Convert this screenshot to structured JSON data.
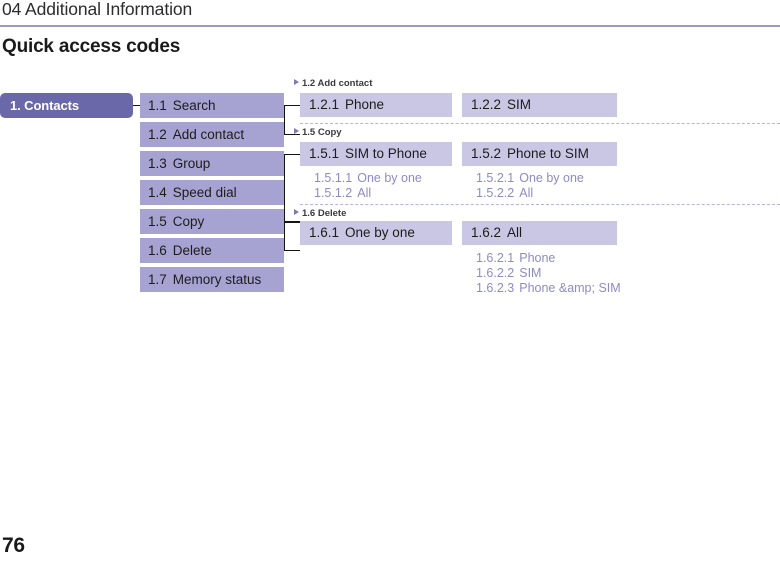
{
  "header": {
    "chapter": "04 Additional Information",
    "title": "Quick access codes",
    "rule_color": "#9c99c4"
  },
  "footer": {
    "page_number": "76"
  },
  "colors": {
    "root_node": "#6a68a8",
    "level1_box": "#a6a3d2",
    "level2_box": "#c9c7e4",
    "leaf_text": "#8d8bc4",
    "dashed_separator": "#b6b3dc",
    "connector": "#141414",
    "triangle": "#7d7ab5"
  },
  "tree": {
    "root": {
      "label": "1. Contacts"
    },
    "level1": [
      {
        "num": "1.1",
        "label": "Search"
      },
      {
        "num": "1.2",
        "label": "Add contact"
      },
      {
        "num": "1.3",
        "label": "Group"
      },
      {
        "num": "1.4",
        "label": "Speed dial"
      },
      {
        "num": "1.5",
        "label": "Copy"
      },
      {
        "num": "1.6",
        "label": "Delete"
      },
      {
        "num": "1.7",
        "label": "Memory status"
      }
    ],
    "groups": [
      {
        "heading": "1.2 Add contact",
        "items": [
          {
            "num": "1.2.1",
            "label": "Phone",
            "children": []
          },
          {
            "num": "1.2.2",
            "label": "SIM",
            "children": []
          }
        ]
      },
      {
        "heading": "1.5 Copy",
        "items": [
          {
            "num": "1.5.1",
            "label": "SIM to Phone",
            "children": [
              {
                "num": "1.5.1.1",
                "label": "One by one"
              },
              {
                "num": "1.5.1.2",
                "label": "All"
              }
            ]
          },
          {
            "num": "1.5.2",
            "label": "Phone to SIM",
            "children": [
              {
                "num": "1.5.2.1",
                "label": "One by one"
              },
              {
                "num": "1.5.2.2",
                "label": "All"
              }
            ]
          }
        ]
      },
      {
        "heading": "1.6 Delete",
        "items": [
          {
            "num": "1.6.1",
            "label": "One by one",
            "children": []
          },
          {
            "num": "1.6.2",
            "label": "All",
            "children": [
              {
                "num": "1.6.2.1",
                "label": "Phone"
              },
              {
                "num": "1.6.2.2",
                "label": "SIM"
              },
              {
                "num": "1.6.2.3",
                "label": "Phone &amp; SIM"
              }
            ]
          }
        ]
      }
    ]
  }
}
